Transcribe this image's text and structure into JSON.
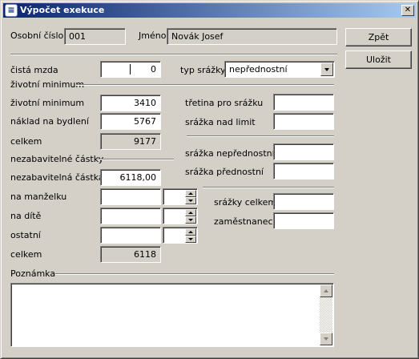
{
  "window": {
    "title": "Výpočet exekuce"
  },
  "header": {
    "employee_number_label": "Osobní číslo",
    "employee_number_value": "001",
    "name_label": "Jméno",
    "name_value": "Novák Josef"
  },
  "buttons": {
    "back_label": "Zpět",
    "save_label": "Uložit"
  },
  "wage": {
    "label": "čistá mzda",
    "value": "0"
  },
  "deduction_type": {
    "label": "typ srážky",
    "selected": "nepřednostní"
  },
  "subsistence_minimum": {
    "group_title": "životní minimum",
    "minimum_label": "životní minimum",
    "minimum_value": "3410",
    "housing_label": "náklad na bydlení",
    "housing_value": "5767",
    "total_label": "celkem",
    "total_value": "9177"
  },
  "non_deductible": {
    "group_title": "nezabavitelné částky",
    "amount_label": "nezabavitelná částka",
    "amount_value": "6118,00",
    "spouse_label": "na manželku",
    "spouse_value": "",
    "spouse_count": "",
    "child_label": "na dítě",
    "child_value": "",
    "child_count": "",
    "other_label": "ostatní",
    "other_value": "",
    "other_count": "",
    "total_label": "celkem",
    "total_value": "6118"
  },
  "deductions": {
    "third_label": "třetina pro srážku",
    "third_value": "",
    "over_limit_label": "srážka nad limit",
    "over_limit_value": "",
    "non_priority_label": "srážka nepřednostní",
    "non_priority_value": "",
    "priority_label": "srážka přednostní",
    "priority_value": "",
    "total_label": "srážky celkem",
    "total_value": "",
    "employee_label": "zaměstnanec",
    "employee_value": ""
  },
  "note": {
    "label": "Poznámka",
    "value": ""
  },
  "icons": {
    "app": "app-icon",
    "close": "close-icon",
    "dropdown": "chevron-down-icon",
    "spin_up": "spin-up-icon",
    "spin_down": "spin-down-icon"
  }
}
